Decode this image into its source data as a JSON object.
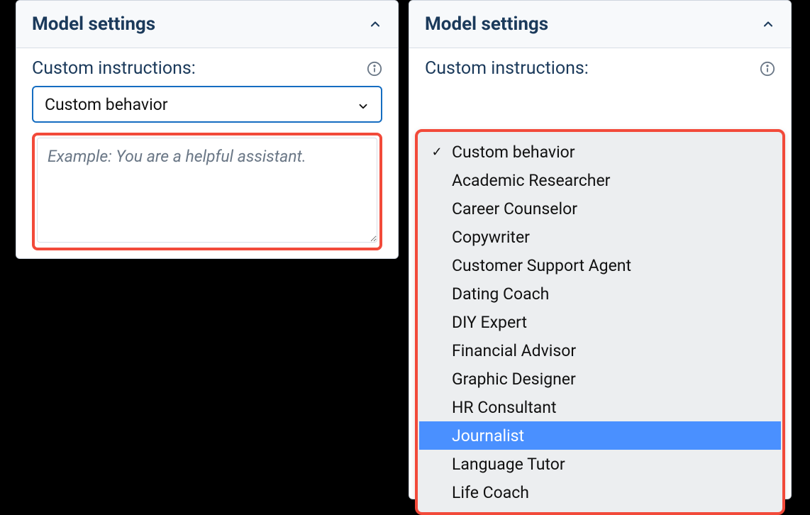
{
  "panel": {
    "title": "Model settings",
    "custom_instructions_label": "Custom instructions:"
  },
  "select": {
    "value": "Custom behavior",
    "placeholder": "Example: You are a helpful assistant."
  },
  "dropdown": {
    "items": [
      {
        "label": "Custom behavior",
        "checked": true,
        "highlighted": false
      },
      {
        "label": "Academic Researcher",
        "checked": false,
        "highlighted": false
      },
      {
        "label": "Career Counselor",
        "checked": false,
        "highlighted": false
      },
      {
        "label": "Copywriter",
        "checked": false,
        "highlighted": false
      },
      {
        "label": "Customer Support Agent",
        "checked": false,
        "highlighted": false
      },
      {
        "label": "Dating Coach",
        "checked": false,
        "highlighted": false
      },
      {
        "label": "DIY Expert",
        "checked": false,
        "highlighted": false
      },
      {
        "label": "Financial Advisor",
        "checked": false,
        "highlighted": false
      },
      {
        "label": "Graphic Designer",
        "checked": false,
        "highlighted": false
      },
      {
        "label": "HR Consultant",
        "checked": false,
        "highlighted": false
      },
      {
        "label": "Journalist",
        "checked": false,
        "highlighted": true
      },
      {
        "label": "Language Tutor",
        "checked": false,
        "highlighted": false
      },
      {
        "label": "Life Coach",
        "checked": false,
        "highlighted": false
      }
    ]
  }
}
